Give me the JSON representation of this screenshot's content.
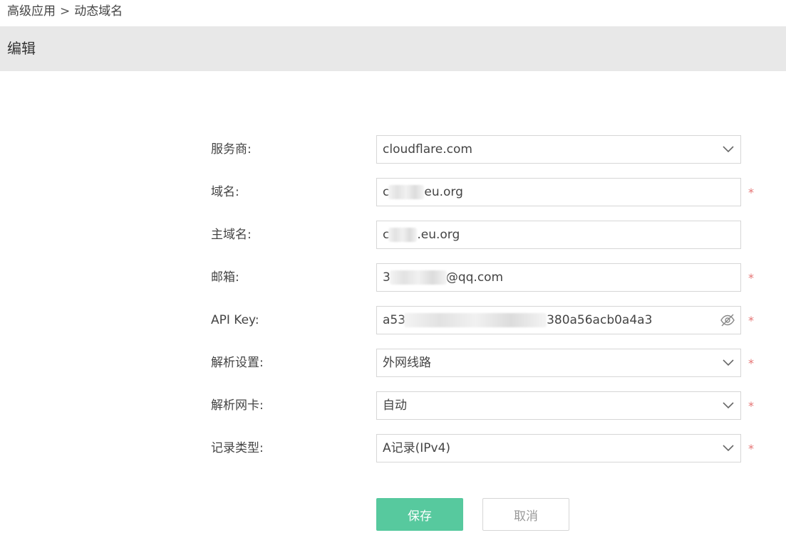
{
  "breadcrumb": {
    "parent": "高级应用",
    "separator": ">",
    "current": "动态域名"
  },
  "panel": {
    "title": "编辑"
  },
  "form": {
    "provider": {
      "label": "服务商:",
      "value": "cloudflare.com",
      "required": ""
    },
    "domain": {
      "label": "域名:",
      "value_prefix": "c",
      "value_suffix": "eu.org",
      "required": "*"
    },
    "main_domain": {
      "label": "主域名:",
      "value_prefix": "c",
      "value_suffix": ".eu.org",
      "required": ""
    },
    "email": {
      "label": "邮箱:",
      "value_prefix": "3",
      "value_suffix": "@qq.com",
      "required": "*"
    },
    "api_key": {
      "label": "API Key:",
      "value_prefix": "a53",
      "value_suffix": "380a56acb0a4a3",
      "required": "*"
    },
    "resolve_setting": {
      "label": "解析设置:",
      "value": "外网线路",
      "required": "*"
    },
    "resolve_nic": {
      "label": "解析网卡:",
      "value": "自动",
      "required": "*"
    },
    "record_type": {
      "label": "记录类型:",
      "value": "A记录(IPv4)",
      "required": "*"
    }
  },
  "buttons": {
    "save": "保存",
    "cancel": "取消"
  },
  "icons": {
    "dropdown": "chevron-down-icon",
    "visibility": "eye-off-icon"
  },
  "colors": {
    "primary": "#57c99e",
    "required": "#e57373",
    "header_bg": "#e8e8e8",
    "border": "#d6d6d6"
  }
}
